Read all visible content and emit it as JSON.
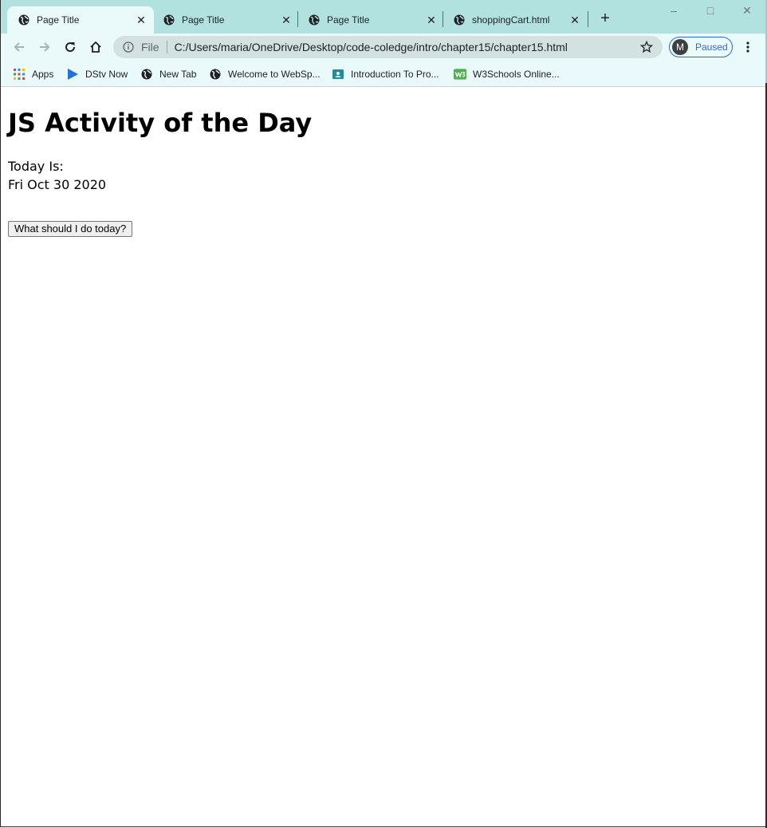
{
  "window": {
    "controls": {
      "minimize": "–",
      "maximize": "□",
      "close": "✕"
    }
  },
  "tabs": [
    {
      "title": "Page Title",
      "active": true,
      "icon": "globe-icon"
    },
    {
      "title": "Page Title",
      "active": false,
      "icon": "globe-icon"
    },
    {
      "title": "Page Title",
      "active": false,
      "icon": "globe-icon"
    },
    {
      "title": "shoppingCart.html",
      "active": false,
      "icon": "globe-icon"
    }
  ],
  "tab_close_glyph": "✕",
  "new_tab_glyph": "+",
  "toolbar": {
    "scheme": "File",
    "url": "C:/Users/maria/OneDrive/Desktop/code-coledge/intro/chapter15/chapter15.html",
    "profile_initial": "M",
    "profile_status": "Paused"
  },
  "bookmarks": [
    {
      "label": "Apps",
      "icon": "apps-grid-icon"
    },
    {
      "label": "DStv Now",
      "icon": "play-icon"
    },
    {
      "label": "New Tab",
      "icon": "globe-icon"
    },
    {
      "label": "Welcome to WebSp...",
      "icon": "globe-icon"
    },
    {
      "label": "Introduction To Pro...",
      "icon": "classroom-icon"
    },
    {
      "label": "W3Schools Online...",
      "icon": "w3schools-icon"
    }
  ],
  "page": {
    "heading": "JS Activity of the Day",
    "today_label": "Today Is:",
    "today_date": "Fri Oct 30 2020",
    "button_label": "What should I do today?"
  },
  "colors": {
    "tabbar": "#b2e2e0",
    "toolbar": "#eafafa",
    "omnibox": "#d3e1e1",
    "profile_accent": "#3367d6"
  }
}
